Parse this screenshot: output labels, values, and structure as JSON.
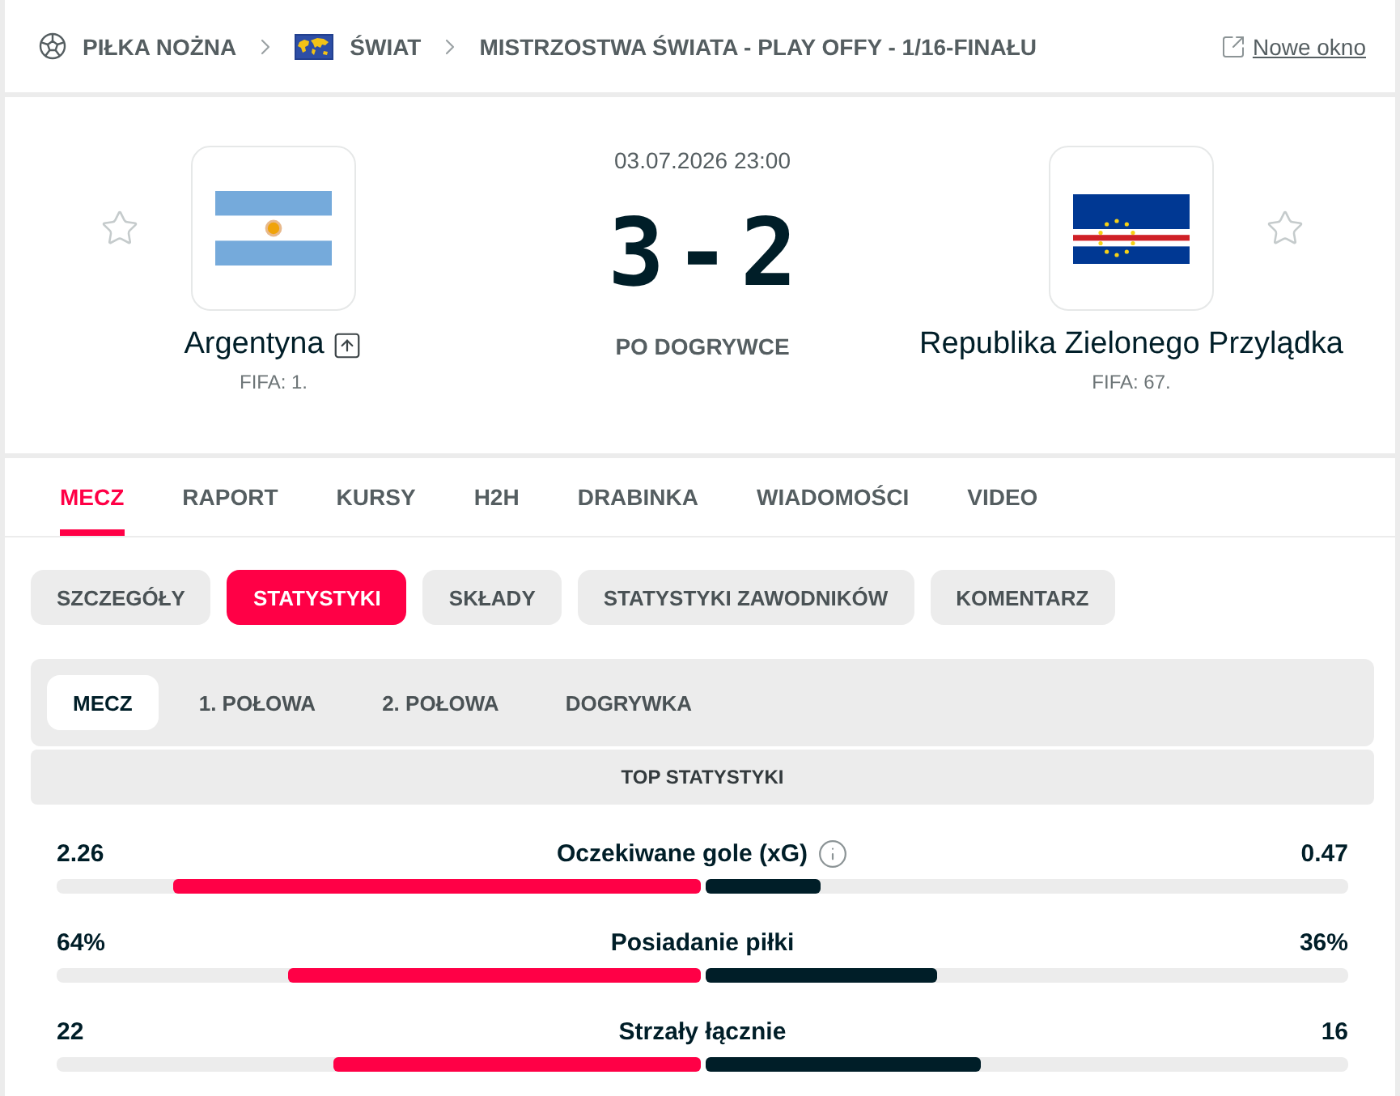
{
  "breadcrumb": {
    "items": [
      {
        "kind": "sport",
        "label": "PIŁKA NOŻNA"
      },
      {
        "kind": "country",
        "label": "ŚWIAT"
      },
      {
        "kind": "league",
        "label": "MISTRZOSTWA ŚWIATA - PLAY OFFY - 1/16-FINAŁU"
      }
    ],
    "new_window": "Nowe okno"
  },
  "match": {
    "home": {
      "name": "Argentyna",
      "rank": "FIFA: 1.",
      "favorite": false,
      "advanced": true
    },
    "date": "03.07.2026 23:00",
    "score": {
      "home": "3",
      "separator": "-",
      "away": "2"
    },
    "status": "PO DOGRYWCE",
    "away": {
      "name": "Republika Zielonego Przylądka",
      "rank": "FIFA: 67.",
      "favorite": false,
      "advanced": false
    }
  },
  "match_tabs": [
    {
      "label": "MECZ",
      "selected": true
    },
    {
      "label": "RAPORT",
      "selected": false
    },
    {
      "label": "KURSY",
      "selected": false
    },
    {
      "label": "H2H",
      "selected": false
    },
    {
      "label": "DRABINKA",
      "selected": false
    },
    {
      "label": "WIADOMOŚCI",
      "selected": false
    },
    {
      "label": "VIDEO",
      "selected": false
    }
  ],
  "detail_tabs": [
    {
      "label": "SZCZEGÓŁY",
      "selected": false
    },
    {
      "label": "STATYSTYKI",
      "selected": true
    },
    {
      "label": "SKŁADY",
      "selected": false
    },
    {
      "label": "STATYSTYKI ZAWODNIKÓW",
      "selected": false
    },
    {
      "label": "KOMENTARZ",
      "selected": false
    }
  ],
  "period_tabs": [
    {
      "label": "MECZ",
      "selected": true
    },
    {
      "label": "1. POŁOWA",
      "selected": false
    },
    {
      "label": "2. POŁOWA",
      "selected": false
    },
    {
      "label": "DOGRYWKA",
      "selected": false
    }
  ],
  "section_title": "TOP STATYSTYKI",
  "stats": [
    {
      "label": "Oczekiwane gole (xG)",
      "info": true,
      "home": {
        "value": "2.26",
        "level": 0.82
      },
      "away": {
        "value": "0.47",
        "level": 0.18
      }
    },
    {
      "label": "Posiadanie piłki",
      "info": false,
      "home": {
        "value": "64%",
        "level": 0.64
      },
      "away": {
        "value": "36%",
        "level": 0.36
      }
    },
    {
      "label": "Strzały łącznie",
      "info": false,
      "home": {
        "value": "22",
        "level": 0.57
      },
      "away": {
        "value": "16",
        "level": 0.43
      }
    }
  ]
}
